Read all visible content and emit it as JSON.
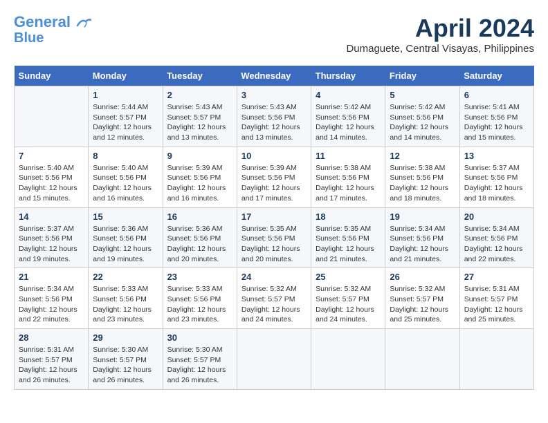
{
  "header": {
    "logo_line1": "General",
    "logo_line2": "Blue",
    "month_title": "April 2024",
    "location": "Dumaguete, Central Visayas, Philippines"
  },
  "weekdays": [
    "Sunday",
    "Monday",
    "Tuesday",
    "Wednesday",
    "Thursday",
    "Friday",
    "Saturday"
  ],
  "weeks": [
    [
      {
        "day": "",
        "sunrise": "",
        "sunset": "",
        "daylight": ""
      },
      {
        "day": "1",
        "sunrise": "Sunrise: 5:44 AM",
        "sunset": "Sunset: 5:57 PM",
        "daylight": "Daylight: 12 hours and 12 minutes."
      },
      {
        "day": "2",
        "sunrise": "Sunrise: 5:43 AM",
        "sunset": "Sunset: 5:57 PM",
        "daylight": "Daylight: 12 hours and 13 minutes."
      },
      {
        "day": "3",
        "sunrise": "Sunrise: 5:43 AM",
        "sunset": "Sunset: 5:56 PM",
        "daylight": "Daylight: 12 hours and 13 minutes."
      },
      {
        "day": "4",
        "sunrise": "Sunrise: 5:42 AM",
        "sunset": "Sunset: 5:56 PM",
        "daylight": "Daylight: 12 hours and 14 minutes."
      },
      {
        "day": "5",
        "sunrise": "Sunrise: 5:42 AM",
        "sunset": "Sunset: 5:56 PM",
        "daylight": "Daylight: 12 hours and 14 minutes."
      },
      {
        "day": "6",
        "sunrise": "Sunrise: 5:41 AM",
        "sunset": "Sunset: 5:56 PM",
        "daylight": "Daylight: 12 hours and 15 minutes."
      }
    ],
    [
      {
        "day": "7",
        "sunrise": "Sunrise: 5:40 AM",
        "sunset": "Sunset: 5:56 PM",
        "daylight": "Daylight: 12 hours and 15 minutes."
      },
      {
        "day": "8",
        "sunrise": "Sunrise: 5:40 AM",
        "sunset": "Sunset: 5:56 PM",
        "daylight": "Daylight: 12 hours and 16 minutes."
      },
      {
        "day": "9",
        "sunrise": "Sunrise: 5:39 AM",
        "sunset": "Sunset: 5:56 PM",
        "daylight": "Daylight: 12 hours and 16 minutes."
      },
      {
        "day": "10",
        "sunrise": "Sunrise: 5:39 AM",
        "sunset": "Sunset: 5:56 PM",
        "daylight": "Daylight: 12 hours and 17 minutes."
      },
      {
        "day": "11",
        "sunrise": "Sunrise: 5:38 AM",
        "sunset": "Sunset: 5:56 PM",
        "daylight": "Daylight: 12 hours and 17 minutes."
      },
      {
        "day": "12",
        "sunrise": "Sunrise: 5:38 AM",
        "sunset": "Sunset: 5:56 PM",
        "daylight": "Daylight: 12 hours and 18 minutes."
      },
      {
        "day": "13",
        "sunrise": "Sunrise: 5:37 AM",
        "sunset": "Sunset: 5:56 PM",
        "daylight": "Daylight: 12 hours and 18 minutes."
      }
    ],
    [
      {
        "day": "14",
        "sunrise": "Sunrise: 5:37 AM",
        "sunset": "Sunset: 5:56 PM",
        "daylight": "Daylight: 12 hours and 19 minutes."
      },
      {
        "day": "15",
        "sunrise": "Sunrise: 5:36 AM",
        "sunset": "Sunset: 5:56 PM",
        "daylight": "Daylight: 12 hours and 19 minutes."
      },
      {
        "day": "16",
        "sunrise": "Sunrise: 5:36 AM",
        "sunset": "Sunset: 5:56 PM",
        "daylight": "Daylight: 12 hours and 20 minutes."
      },
      {
        "day": "17",
        "sunrise": "Sunrise: 5:35 AM",
        "sunset": "Sunset: 5:56 PM",
        "daylight": "Daylight: 12 hours and 20 minutes."
      },
      {
        "day": "18",
        "sunrise": "Sunrise: 5:35 AM",
        "sunset": "Sunset: 5:56 PM",
        "daylight": "Daylight: 12 hours and 21 minutes."
      },
      {
        "day": "19",
        "sunrise": "Sunrise: 5:34 AM",
        "sunset": "Sunset: 5:56 PM",
        "daylight": "Daylight: 12 hours and 21 minutes."
      },
      {
        "day": "20",
        "sunrise": "Sunrise: 5:34 AM",
        "sunset": "Sunset: 5:56 PM",
        "daylight": "Daylight: 12 hours and 22 minutes."
      }
    ],
    [
      {
        "day": "21",
        "sunrise": "Sunrise: 5:34 AM",
        "sunset": "Sunset: 5:56 PM",
        "daylight": "Daylight: 12 hours and 22 minutes."
      },
      {
        "day": "22",
        "sunrise": "Sunrise: 5:33 AM",
        "sunset": "Sunset: 5:56 PM",
        "daylight": "Daylight: 12 hours and 23 minutes."
      },
      {
        "day": "23",
        "sunrise": "Sunrise: 5:33 AM",
        "sunset": "Sunset: 5:56 PM",
        "daylight": "Daylight: 12 hours and 23 minutes."
      },
      {
        "day": "24",
        "sunrise": "Sunrise: 5:32 AM",
        "sunset": "Sunset: 5:57 PM",
        "daylight": "Daylight: 12 hours and 24 minutes."
      },
      {
        "day": "25",
        "sunrise": "Sunrise: 5:32 AM",
        "sunset": "Sunset: 5:57 PM",
        "daylight": "Daylight: 12 hours and 24 minutes."
      },
      {
        "day": "26",
        "sunrise": "Sunrise: 5:32 AM",
        "sunset": "Sunset: 5:57 PM",
        "daylight": "Daylight: 12 hours and 25 minutes."
      },
      {
        "day": "27",
        "sunrise": "Sunrise: 5:31 AM",
        "sunset": "Sunset: 5:57 PM",
        "daylight": "Daylight: 12 hours and 25 minutes."
      }
    ],
    [
      {
        "day": "28",
        "sunrise": "Sunrise: 5:31 AM",
        "sunset": "Sunset: 5:57 PM",
        "daylight": "Daylight: 12 hours and 26 minutes."
      },
      {
        "day": "29",
        "sunrise": "Sunrise: 5:30 AM",
        "sunset": "Sunset: 5:57 PM",
        "daylight": "Daylight: 12 hours and 26 minutes."
      },
      {
        "day": "30",
        "sunrise": "Sunrise: 5:30 AM",
        "sunset": "Sunset: 5:57 PM",
        "daylight": "Daylight: 12 hours and 26 minutes."
      },
      {
        "day": "",
        "sunrise": "",
        "sunset": "",
        "daylight": ""
      },
      {
        "day": "",
        "sunrise": "",
        "sunset": "",
        "daylight": ""
      },
      {
        "day": "",
        "sunrise": "",
        "sunset": "",
        "daylight": ""
      },
      {
        "day": "",
        "sunrise": "",
        "sunset": "",
        "daylight": ""
      }
    ]
  ]
}
